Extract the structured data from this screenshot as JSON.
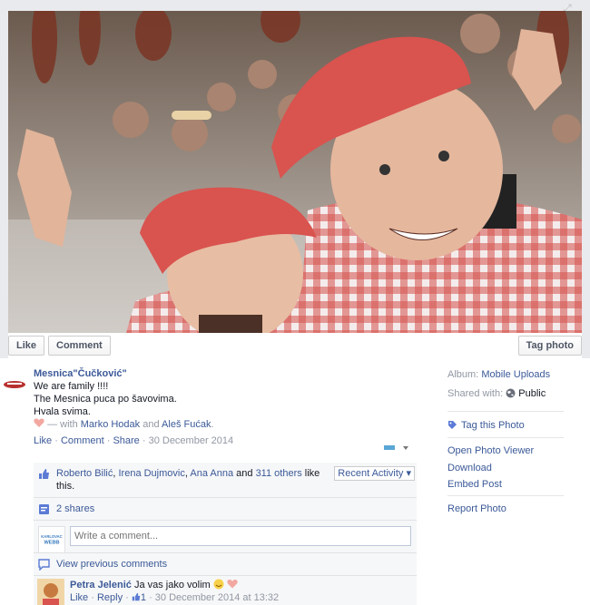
{
  "photo_actions": {
    "like": "Like",
    "comment": "Comment",
    "tag_photo": "Tag photo"
  },
  "post": {
    "author": "Mesnica\"Čučković\"",
    "lines": [
      "We are family !!!!",
      "The Mesnica puca po šavovima.",
      "Hvala svima."
    ],
    "with_prefix": "— with",
    "with_people": [
      "Marko Hodak",
      "Aleš Fućak"
    ],
    "with_joiner": "and",
    "actions": {
      "like": "Like",
      "comment": "Comment",
      "share": "Share",
      "date": "30 December 2014"
    }
  },
  "ufi": {
    "likes": {
      "names": [
        "Roberto Bilić",
        "Irena Dujmovic",
        "Ana Anna"
      ],
      "and": "and",
      "others": "311 others",
      "suffix": "like this."
    },
    "recent_activity": "Recent Activity ▾",
    "shares": "2 shares",
    "comment_placeholder": "Write a comment...",
    "composer_avatar_text": "KARLOVAC WEBB",
    "view_previous": "View previous comments",
    "comment": {
      "name": "Petra Jelenić",
      "text": "Ja vas jako volim",
      "like": "Like",
      "reply": "Reply",
      "likes_count": "1",
      "timestamp": "30 December 2014 at 13:32"
    }
  },
  "side": {
    "album_label": "Album:",
    "album_value": "Mobile Uploads",
    "shared_label": "Shared with:",
    "shared_value": "Public",
    "tag_this_photo": "Tag this Photo",
    "open_viewer": "Open Photo Viewer",
    "download": "Download",
    "embed": "Embed Post",
    "report": "Report Photo"
  },
  "colors": {
    "link": "#3b5998",
    "muted": "#9197a3",
    "ufi_bg": "#f6f7f8",
    "hat": "#d9534f"
  }
}
